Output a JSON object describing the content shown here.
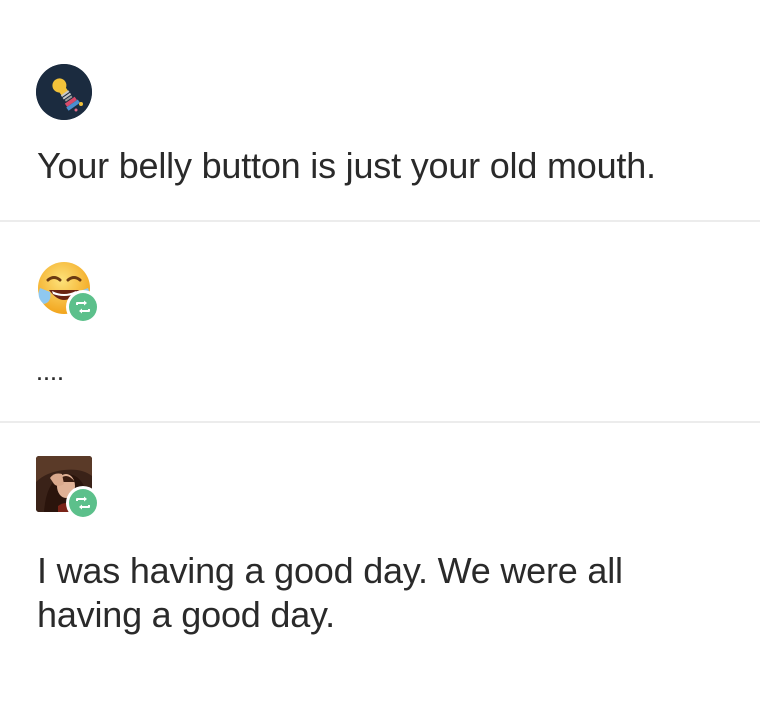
{
  "posts": [
    {
      "avatar_icon": "lightbulb-avatar-icon",
      "reblogged": false,
      "text": "Your belly button is just your old mouth."
    },
    {
      "avatar_icon": "crying-laughing-emoji-avatar-icon",
      "reblogged": true,
      "text": "...."
    },
    {
      "avatar_icon": "portrait-photo-avatar-icon",
      "reblogged": true,
      "text": "I was having a good day. We were all having a good day."
    }
  ],
  "colors": {
    "text": "#2a2a2a",
    "divider": "#ececec",
    "reblog_badge": "#5cc08b",
    "avatar1_bg": "#1b2b3f"
  },
  "icons": {
    "reblog": "reblog-icon"
  }
}
